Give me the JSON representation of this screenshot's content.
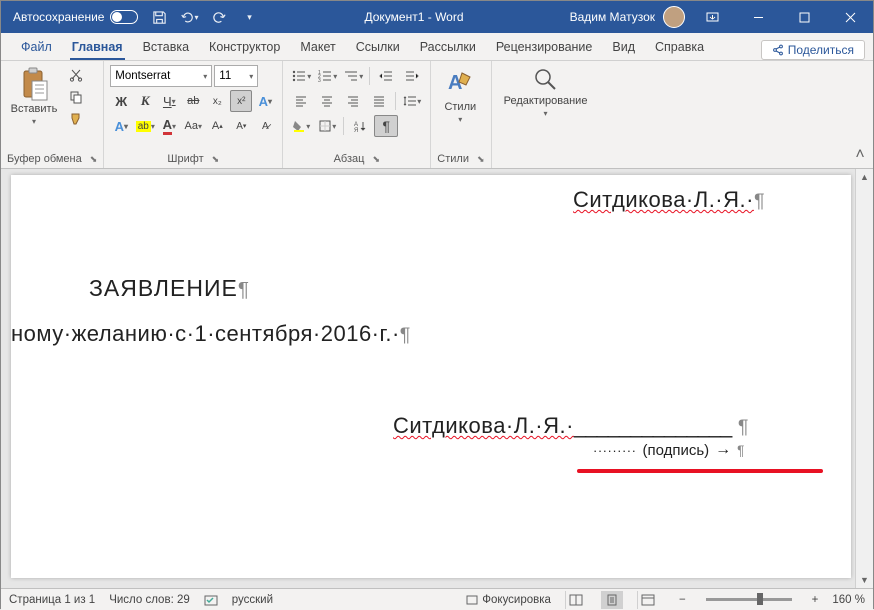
{
  "titlebar": {
    "autosave": "Автосохранение",
    "title": "Документ1 - Word",
    "user": "Вадим Матузок"
  },
  "tabs": {
    "file": "Файл",
    "home": "Главная",
    "insert": "Вставка",
    "design": "Конструктор",
    "layout": "Макет",
    "references": "Ссылки",
    "mailings": "Рассылки",
    "review": "Рецензирование",
    "view": "Вид",
    "help": "Справка",
    "share": "Поделиться"
  },
  "ribbon": {
    "clipboard": {
      "paste": "Вставить",
      "label": "Буфер обмена"
    },
    "font": {
      "name": "Montserrat",
      "size": "11",
      "label": "Шрифт"
    },
    "paragraph": {
      "label": "Абзац"
    },
    "styles": {
      "btn": "Стили",
      "label": "Стили"
    },
    "editing": {
      "btn": "Редактирование"
    }
  },
  "document": {
    "name_top": "Ситдикова·Л.·Я.·",
    "heading": "ЗАЯВЛЕНИЕ",
    "body": "ному·желанию·с·1·сентября·2016·г.·",
    "name_bot": "Ситдикова·Л.·Я.·",
    "underline": "______________",
    "podpis": "(подпись)"
  },
  "statusbar": {
    "page": "Страница 1 из 1",
    "words": "Число слов: 29",
    "lang": "русский",
    "focus": "Фокусировка",
    "zoom": "160 %"
  }
}
